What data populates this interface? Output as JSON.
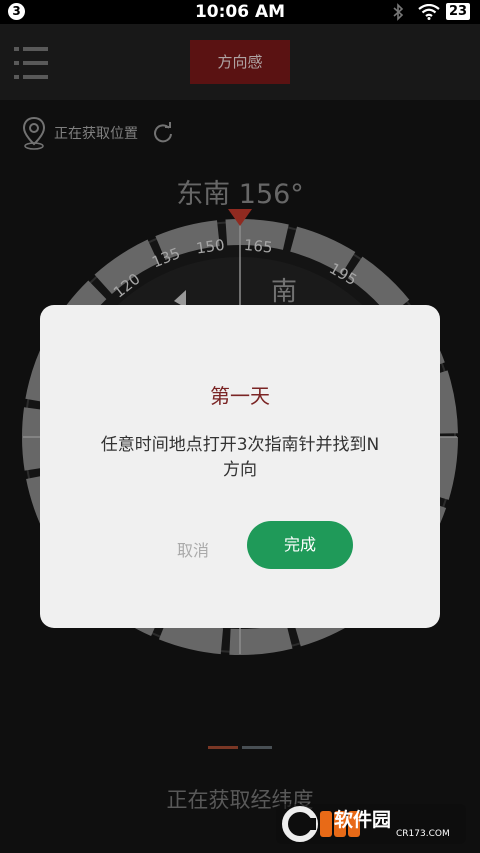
{
  "status_bar": {
    "notification_count": "3",
    "time": "10:06 AM",
    "battery": "23"
  },
  "app_bar": {
    "title": "方向感"
  },
  "location": {
    "status": "正在获取位置"
  },
  "compass": {
    "heading_text": "东南 156°",
    "dial_numbers": [
      "120",
      "135",
      "150",
      "165",
      "195"
    ],
    "cardinal_visible": "南"
  },
  "bottom": {
    "status": "正在获取经纬度"
  },
  "dialog": {
    "title": "第一天",
    "message": "任意时间地点打开3次指南针并找到N方向",
    "cancel_label": "取消",
    "confirm_label": "完成"
  },
  "watermark": {
    "text": "软件园",
    "site": "CR173.COM"
  }
}
